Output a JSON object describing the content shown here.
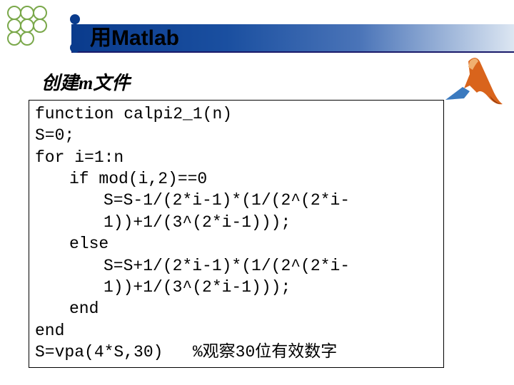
{
  "header": {
    "title": "用Matlab",
    "subtitle": "创建m文件"
  },
  "code": {
    "l1": "function calpi2_1(n)",
    "l2": "S=0;",
    "l3": "for i=1:n",
    "l4": "if mod(i,2)==0",
    "l5": "S=S-1/(2*i-1)*(1/(2^(2*i-1))+1/(3^(2*i-1)));",
    "l6": "else",
    "l7": "S=S+1/(2*i-1)*(1/(2^(2*i-1))+1/(3^(2*i-1)));",
    "l8": "end",
    "l9": "end",
    "l10": "S=vpa(4*S,30)   %观察30位有效数字"
  }
}
